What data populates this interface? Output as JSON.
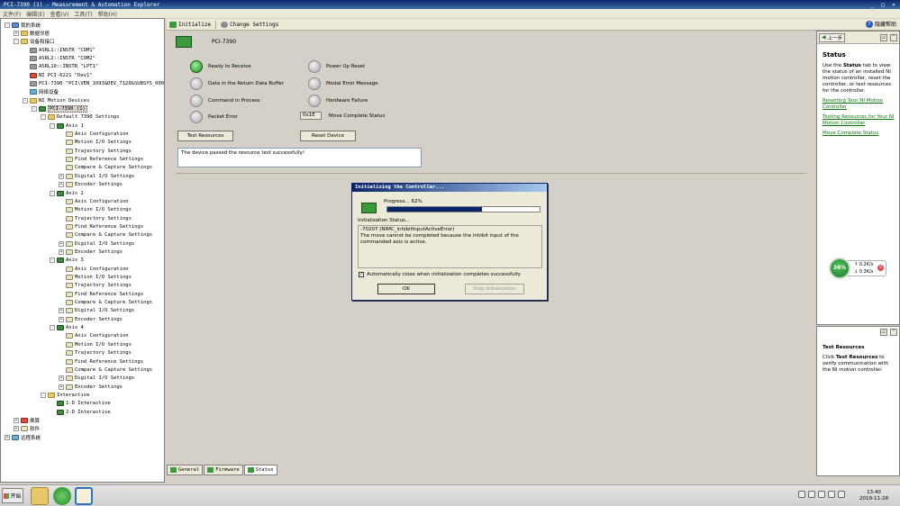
{
  "window": {
    "title": "PCI-7390 (1) - Measurement & Automation Explorer",
    "controls": [
      "_",
      "□",
      "×"
    ]
  },
  "menu": [
    "文件(F)",
    "编辑(E)",
    "查看(V)",
    "工具(T)",
    "帮助(H)"
  ],
  "tree": [
    {
      "label": "我的系统",
      "level": 0,
      "toggle": "-",
      "icon": "pc"
    },
    {
      "label": "数据邻居",
      "level": 1,
      "toggle": "+",
      "icon": "folder"
    },
    {
      "label": "设备和接口",
      "level": 1,
      "toggle": "-",
      "icon": "folder"
    },
    {
      "label": "ASRL1::INSTR \"COM1\"",
      "level": 2,
      "toggle": "",
      "icon": "dev"
    },
    {
      "label": "ASRL2::INSTR \"COM2\"",
      "level": 2,
      "toggle": "",
      "icon": "dev"
    },
    {
      "label": "ASRL10::INSTR \"LPT1\"",
      "level": 2,
      "toggle": "",
      "icon": "dev"
    },
    {
      "label": "NI PCI-6221 \"Dev1\"",
      "level": 2,
      "toggle": "",
      "icon": "red"
    },
    {
      "label": "PCI-7390 \"PCI\\VEN_1093&DEV_7120&SUBSYS_00000",
      "level": 2,
      "toggle": "",
      "icon": "dev"
    },
    {
      "label": "网络设备",
      "level": 2,
      "toggle": "",
      "icon": "net"
    },
    {
      "label": "NI Motion Devices",
      "level": 2,
      "toggle": "-",
      "icon": "folder"
    },
    {
      "label": "PCI-7390 (1)",
      "level": 3,
      "toggle": "-",
      "icon": "axis",
      "selected": true
    },
    {
      "label": "Default 7390 Settings",
      "level": 4,
      "toggle": "-",
      "icon": "folder"
    },
    {
      "label": "Axis 1",
      "level": 5,
      "toggle": "-",
      "icon": "axis"
    },
    {
      "label": "Axis Configuration",
      "level": 6,
      "toggle": "",
      "icon": "cfg"
    },
    {
      "label": "Motion I/O Settings",
      "level": 6,
      "toggle": "",
      "icon": "cfg"
    },
    {
      "label": "Trajectory Settings",
      "level": 6,
      "toggle": "",
      "icon": "cfg"
    },
    {
      "label": "Find Reference Settings",
      "level": 6,
      "toggle": "",
      "icon": "cfg"
    },
    {
      "label": "Compare & Capture Settings",
      "level": 6,
      "toggle": "",
      "icon": "cfg"
    },
    {
      "label": "Digital I/O Settings",
      "level": 6,
      "toggle": "+",
      "icon": "cfg"
    },
    {
      "label": "Encoder Settings",
      "level": 6,
      "toggle": "+",
      "icon": "cfg"
    },
    {
      "label": "Axis 2",
      "level": 5,
      "toggle": "-",
      "icon": "axis"
    },
    {
      "label": "Axis Configuration",
      "level": 6,
      "toggle": "",
      "icon": "cfg"
    },
    {
      "label": "Motion I/O Settings",
      "level": 6,
      "toggle": "",
      "icon": "cfg"
    },
    {
      "label": "Trajectory Settings",
      "level": 6,
      "toggle": "",
      "icon": "cfg"
    },
    {
      "label": "Find Reference Settings",
      "level": 6,
      "toggle": "",
      "icon": "cfg"
    },
    {
      "label": "Compare & Capture Settings",
      "level": 6,
      "toggle": "",
      "icon": "cfg"
    },
    {
      "label": "Digital I/O Settings",
      "level": 6,
      "toggle": "+",
      "icon": "cfg"
    },
    {
      "label": "Encoder Settings",
      "level": 6,
      "toggle": "+",
      "icon": "cfg"
    },
    {
      "label": "Axis 3",
      "level": 5,
      "toggle": "-",
      "icon": "axis"
    },
    {
      "label": "Axis Configuration",
      "level": 6,
      "toggle": "",
      "icon": "cfg"
    },
    {
      "label": "Motion I/O Settings",
      "level": 6,
      "toggle": "",
      "icon": "cfg"
    },
    {
      "label": "Trajectory Settings",
      "level": 6,
      "toggle": "",
      "icon": "cfg"
    },
    {
      "label": "Find Reference Settings",
      "level": 6,
      "toggle": "",
      "icon": "cfg"
    },
    {
      "label": "Compare & Capture Settings",
      "level": 6,
      "toggle": "",
      "icon": "cfg"
    },
    {
      "label": "Digital I/O Settings",
      "level": 6,
      "toggle": "+",
      "icon": "cfg"
    },
    {
      "label": "Encoder Settings",
      "level": 6,
      "toggle": "+",
      "icon": "cfg"
    },
    {
      "label": "Axis 4",
      "level": 5,
      "toggle": "-",
      "icon": "axis"
    },
    {
      "label": "Axis Configuration",
      "level": 6,
      "toggle": "",
      "icon": "cfg"
    },
    {
      "label": "Motion I/O Settings",
      "level": 6,
      "toggle": "",
      "icon": "cfg"
    },
    {
      "label": "Trajectory Settings",
      "level": 6,
      "toggle": "",
      "icon": "cfg"
    },
    {
      "label": "Find Reference Settings",
      "level": 6,
      "toggle": "",
      "icon": "cfg"
    },
    {
      "label": "Compare & Capture Settings",
      "level": 6,
      "toggle": "",
      "icon": "cfg"
    },
    {
      "label": "Digital I/O Settings",
      "level": 6,
      "toggle": "+",
      "icon": "cfg"
    },
    {
      "label": "Encoder Settings",
      "level": 6,
      "toggle": "+",
      "icon": "cfg"
    },
    {
      "label": "Interactive",
      "level": 4,
      "toggle": "-",
      "icon": "folder"
    },
    {
      "label": "1-D Interactive",
      "level": 5,
      "toggle": "",
      "icon": "axis"
    },
    {
      "label": "2-D Interactive",
      "level": 5,
      "toggle": "",
      "icon": "axis"
    },
    {
      "label": "换算",
      "level": 1,
      "toggle": "+",
      "icon": "red"
    },
    {
      "label": "软件",
      "level": 1,
      "toggle": "+",
      "icon": "cfg"
    },
    {
      "label": "远程系统",
      "level": 0,
      "toggle": "+",
      "icon": "net"
    }
  ],
  "toolbar": {
    "initialize": "Initialize",
    "change_settings": "Change Settings",
    "hide_help": "隐藏帮助"
  },
  "main": {
    "device_name": "PCI-7390",
    "indicators": [
      {
        "label": "Ready to Receive",
        "on": true
      },
      {
        "label": "Data in the Return Data Buffer",
        "on": false
      },
      {
        "label": "Command in Process",
        "on": false
      },
      {
        "label": "Packet Error",
        "on": false
      },
      {
        "label": "Power Up Reset",
        "on": false
      },
      {
        "label": "Modal Error Message",
        "on": false
      },
      {
        "label": "Hardware Failure",
        "on": false
      },
      {
        "label": "Move Complete Status",
        "hex": "0x1E"
      }
    ],
    "test_resources": "Test Resources",
    "reset_device": "Reset Device",
    "result_text": "The device passed the resource test successfully!"
  },
  "bottom_tabs": [
    "General",
    "Firmware",
    "Status"
  ],
  "dialog": {
    "title": "Initializing the Controller...",
    "progress_label": "Progress... 62%",
    "progress": 0.62,
    "status_label": "Initialization Status...",
    "status_lines": [
      "-70207 (NIMC_inhibitInputActiveError)",
      "The move cannot be completed because the inhibit input of the commanded axis is active."
    ],
    "auto_close": "Automatically close when initialization completes successfully",
    "ok": "OK",
    "stop": "Stop Initialization"
  },
  "help": {
    "back": "上一步",
    "title": "Status",
    "body_pre": "Use the ",
    "body_bold": "Status",
    "body_post": " tab to view the status of an installed NI motion controller, reset the controller, or test resources for the controller.",
    "links": [
      "Resetting Your NI Motion Controller",
      "Testing Resources for Your NI Motion Controller",
      "Move Complete Status"
    ],
    "bottom_title": "Test Resources",
    "bottom_pre": "Click ",
    "bottom_bold": "Test Resources",
    "bottom_post": " to verify communication with the NI motion controller."
  },
  "netwidget": {
    "percent": "36%",
    "up": "0.2K/s",
    "down": "0.3K/s"
  },
  "taskbar": {
    "start": "开始",
    "time": "13:40",
    "date": "2019-11-28"
  },
  "colors": {
    "accent": "#0a246a",
    "link": "#0a7a0a",
    "led_on": "#1f8a1f"
  }
}
